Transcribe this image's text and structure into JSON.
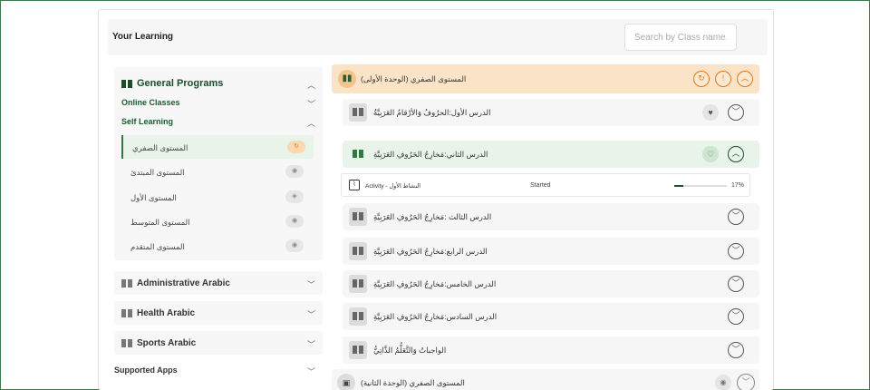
{
  "header": {
    "title": "Your Learning",
    "search_placeholder": "Search by Class name..."
  },
  "sidebar": {
    "general_programs": "General Programs",
    "online_classes": "Online Classes",
    "self_learning": "Self Learning",
    "levels": [
      "المستوى الصفري",
      "المستوى المبتدئ",
      "المستوى الأول",
      "المستوى المتوسط",
      "المستوى المتقدم"
    ],
    "categories": [
      "Administrative Arabic",
      "Health Arabic",
      "Sports Arabic"
    ],
    "supported_apps": "Supported Apps"
  },
  "main": {
    "unit1_title": "المستوى الصفري (الوحدة الأولى)",
    "lessons": [
      "الدرس الأول:الحرُوفُ وَالأرْقامُ العَرَبِيَّةُ",
      "الدرس الثاني:مَخارِجُ الحَرُوفِ العَرَبِيَّةِ",
      "الدرس الثالث :مَخارِجُ الحَرُوفِ العَرَبِيَّةِ",
      "الدرس الرابع:مَخارِجُ الحَرُوفِ العَرَبِيَّةِ",
      "الدرس الخامس:مَخارِجُ الحَرُوفِ العَرَبِيَّةِ",
      "الدرس السادس:مَخارِجُ الحَرُوفِ العَرَبِيَّةِ",
      "الواجباتُ وَالتَّعَلُّمُ الذَّاتِيُّ"
    ],
    "activity": {
      "name": "Activity - النشاط الأول",
      "status": "Started",
      "progress": 17,
      "progress_label": "17%"
    },
    "unit2_title": "المستوى الصفري (الوحدة الثانية)"
  },
  "colors": {
    "accent_green": "#1a4d28",
    "accent_orange": "#e07820",
    "unit_highlight": "#fbe3c8"
  }
}
